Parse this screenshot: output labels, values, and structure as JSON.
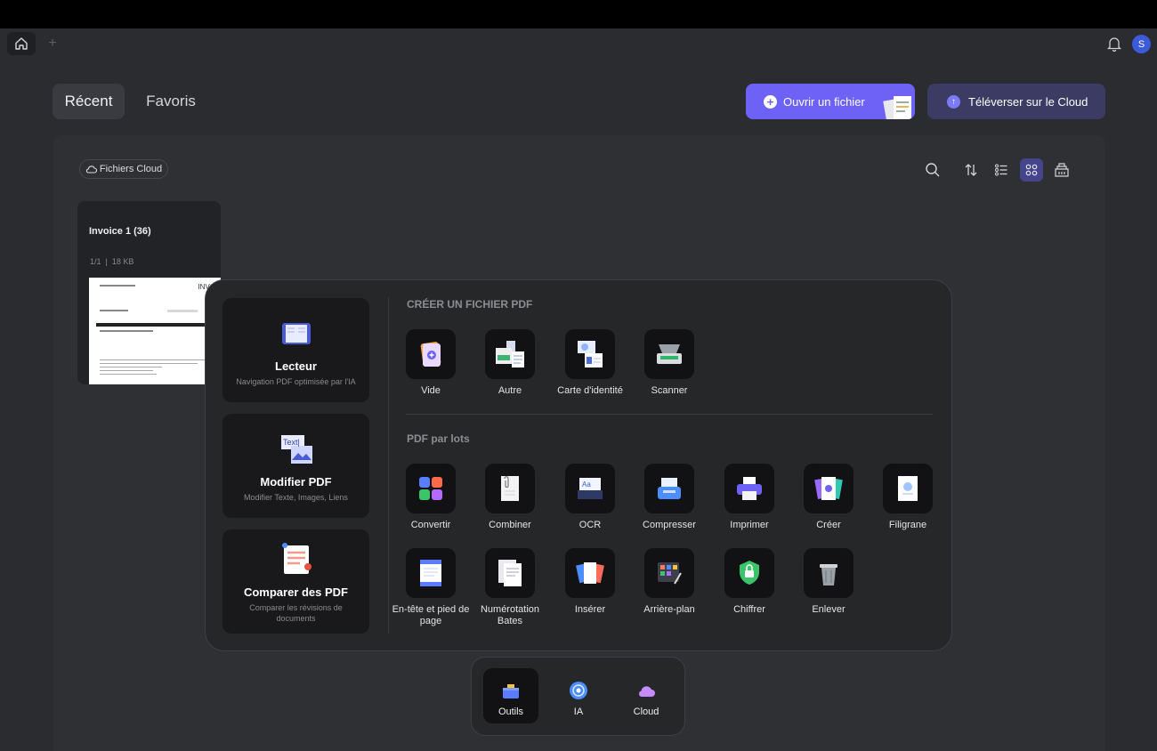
{
  "header": {
    "avatar_initial": "S"
  },
  "tabs": {
    "recent": "Récent",
    "favorites": "Favoris"
  },
  "actions": {
    "open_file": "Ouvrir un fichier",
    "upload_cloud": "Téléverser sur le Cloud"
  },
  "filter": {
    "cloud_files": "Fichiers Cloud"
  },
  "toolbar_icons": [
    "search-icon",
    "sort-icon",
    "list-view-icon",
    "grid-view-icon",
    "batch-icon"
  ],
  "file": {
    "name": "Invoice 1 (36)",
    "pages": "1/1",
    "size": "18 KB",
    "thumb_heading": "INVO"
  },
  "popup": {
    "left": [
      {
        "title": "Lecteur",
        "subtitle": "Navigation PDF optimisée par l'IA"
      },
      {
        "title": "Modifier PDF",
        "subtitle": "Modifier Texte, Images, Liens"
      },
      {
        "title": "Comparer des PDF",
        "subtitle": "Comparer les révisions de documents"
      }
    ],
    "create_heading": "CRÉER UN FICHIER PDF",
    "create_items": [
      "Vide",
      "Autre",
      "Carte d'identité",
      "Scanner"
    ],
    "batch_heading": "PDF par lots",
    "batch_items_row1": [
      "Convertir",
      "Combiner",
      "OCR",
      "Compresser",
      "Imprimer",
      "Créer",
      "Filigrane"
    ],
    "batch_items_row2": [
      "En-tête et pied de page",
      "Numérotation Bates",
      "Insérer",
      "Arrière-plan",
      "Chiffrer",
      "Enlever"
    ]
  },
  "dock": {
    "tools": "Outils",
    "ai": "IA",
    "cloud": "Cloud"
  },
  "colors": {
    "accent": "#6d62f5",
    "cloud_button": "#3b3b64",
    "background": "#2b2c2f"
  }
}
